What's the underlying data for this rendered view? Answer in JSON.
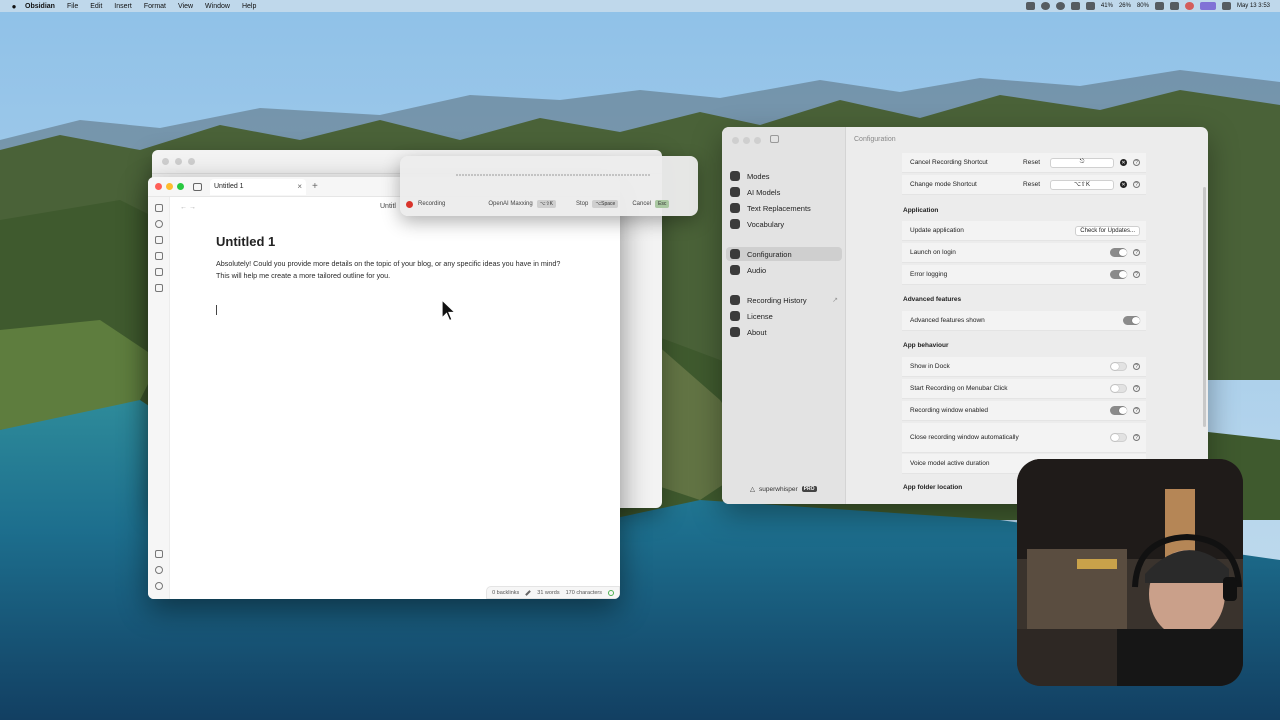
{
  "menubar": {
    "app_name": "Obsidian",
    "items": [
      "File",
      "Edit",
      "Insert",
      "Format",
      "View",
      "Window",
      "Help"
    ],
    "stats": [
      "41%",
      "26%",
      "80%"
    ],
    "datetime": "May 13  3:53"
  },
  "obsidian": {
    "tab_title": "Untitled 1",
    "tab_close": "×",
    "new_tab": "+",
    "crumb": "Untitl",
    "note_title": "Untitled 1",
    "note_body": "Absolutely! Could you provide more details on the topic of your blog, or any specific ideas you have in mind? This will help me create a more tailored outline for you.",
    "status": {
      "backlinks": "0 backlinks",
      "words": "31 words",
      "characters": "170 characters"
    }
  },
  "recording": {
    "status_label": "Recording",
    "mode_label": "OpenAI Maxxing",
    "mode_shortcut": "⌥⇧K",
    "stop_label": "Stop",
    "stop_shortcut": "⌥Space",
    "cancel_label": "Cancel",
    "cancel_shortcut": "Esc"
  },
  "superwhisper": {
    "title": "Configuration",
    "nav": [
      {
        "label": "Modes"
      },
      {
        "label": "AI Models"
      },
      {
        "label": "Text Replacements"
      },
      {
        "label": "Vocabulary"
      },
      {
        "label": "Configuration"
      },
      {
        "label": "Audio"
      },
      {
        "label": "Recording History",
        "arrow": "↗"
      },
      {
        "label": "License"
      },
      {
        "label": "About"
      }
    ],
    "brand": "superwhisper",
    "brand_badge": "PRO",
    "shortcuts": [
      {
        "label": "Cancel Recording Shortcut",
        "reset": "Reset",
        "value": "⎋"
      },
      {
        "label": "Change mode Shortcut",
        "reset": "Reset",
        "value": "⌥⇧K"
      }
    ],
    "sections": {
      "application": "Application",
      "advanced": "Advanced features",
      "behaviour": "App behaviour",
      "folder": "App folder location"
    },
    "application_rows": {
      "update_label": "Update application",
      "update_button": "Check for Updates...",
      "launch_label": "Launch on login",
      "error_label": "Error logging"
    },
    "advanced_rows": {
      "advanced_label": "Advanced features shown"
    },
    "behaviour_rows": [
      {
        "label": "Show in Dock",
        "on": false
      },
      {
        "label": "Start Recording on Menubar Click",
        "on": false
      },
      {
        "label": "Recording window enabled",
        "on": true
      },
      {
        "label": "Close recording window automatically",
        "on": false
      },
      {
        "label": "Voice model active duration"
      }
    ],
    "help_glyph": "?",
    "clear_glyph": "✕"
  },
  "colors": {
    "recording_red": "#d9342b",
    "toggle_on": "#8a8a8a",
    "accent_purple": "#6b4fcf"
  }
}
